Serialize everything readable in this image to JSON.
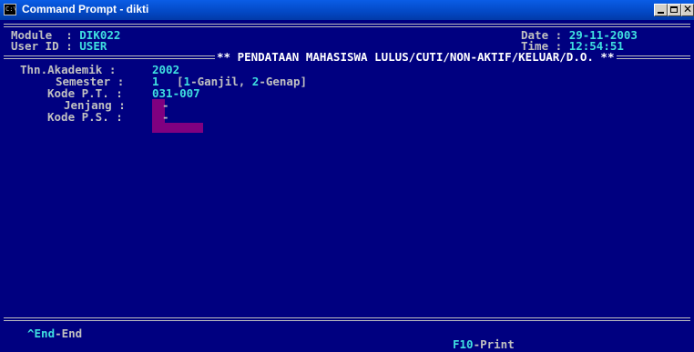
{
  "window": {
    "title": "Command Prompt - dikti",
    "icon_label": "C:\\"
  },
  "header": {
    "module_label": "Module  : ",
    "module_value": "DIK022",
    "userid_label": "User ID : ",
    "userid_value": "USER",
    "date_label": "Date : ",
    "date_value": "29-11-2003",
    "time_label": "Time : ",
    "time_value": "12:54:51",
    "screen_title": "** PENDATAAN MAHASISWA LULUS/CUTI/NON-AKTIF/KELUAR/D.O. **"
  },
  "form": {
    "thn_akademik_label": "Thn.Akademik : ",
    "thn_akademik_value": "2002",
    "semester_label": "Semester : ",
    "semester_value": "1",
    "semester_hint_open": "[",
    "semester_hint_1": "1",
    "semester_hint_2": "-Ganjil, ",
    "semester_hint_3": "2",
    "semester_hint_4": "-Genap]",
    "kode_pt_label": "Kode P.T. : ",
    "kode_pt_value": "031-007",
    "jenjang_label": "Jenjang : ",
    "jenjang_value": "-",
    "kode_ps_label": "Kode P.S. : ",
    "kode_ps_value": "-"
  },
  "footer": {
    "end_key": "^End",
    "end_action": "-End",
    "print_key": "F10",
    "print_action": "-Print"
  }
}
